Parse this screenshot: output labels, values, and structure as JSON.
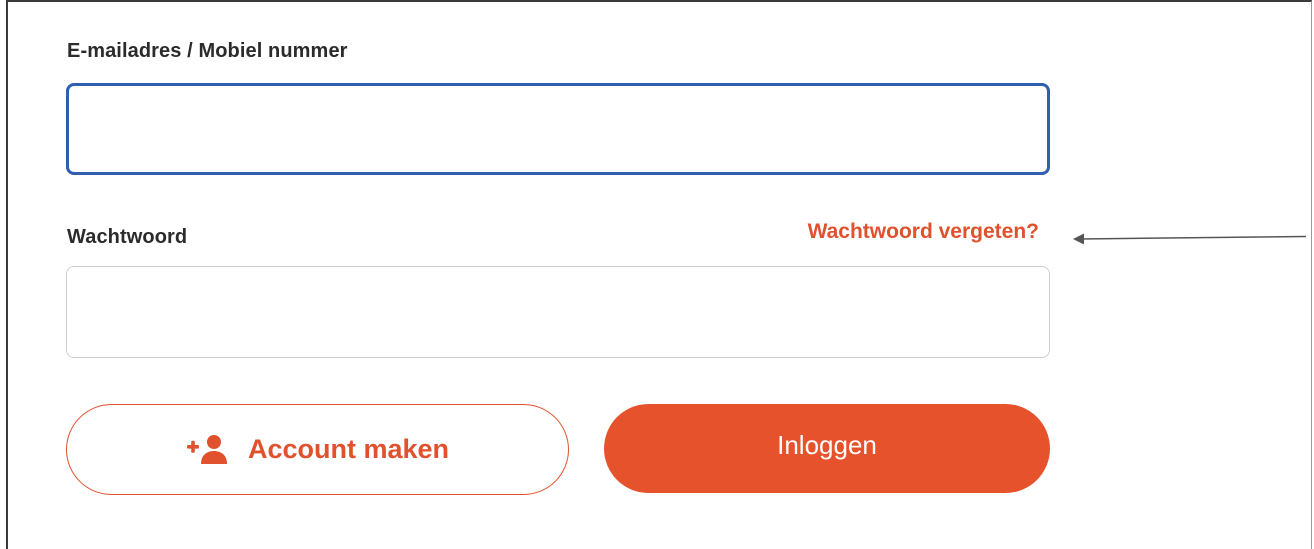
{
  "form": {
    "email_label": "E-mailadres / Mobiel nummer",
    "email_value": "",
    "password_label": "Wachtwoord",
    "password_value": "",
    "forgot_password_link": "Wachtwoord vergeten?",
    "create_account_button": "Account maken",
    "create_account_icon": "add-user-icon",
    "login_button": "Inloggen"
  },
  "annotation": {
    "arrow_icon": "left-arrow-icon"
  },
  "colors": {
    "accent": "#e6522c",
    "focus_border": "#2f5fae",
    "label_text": "#2b2b2b"
  }
}
